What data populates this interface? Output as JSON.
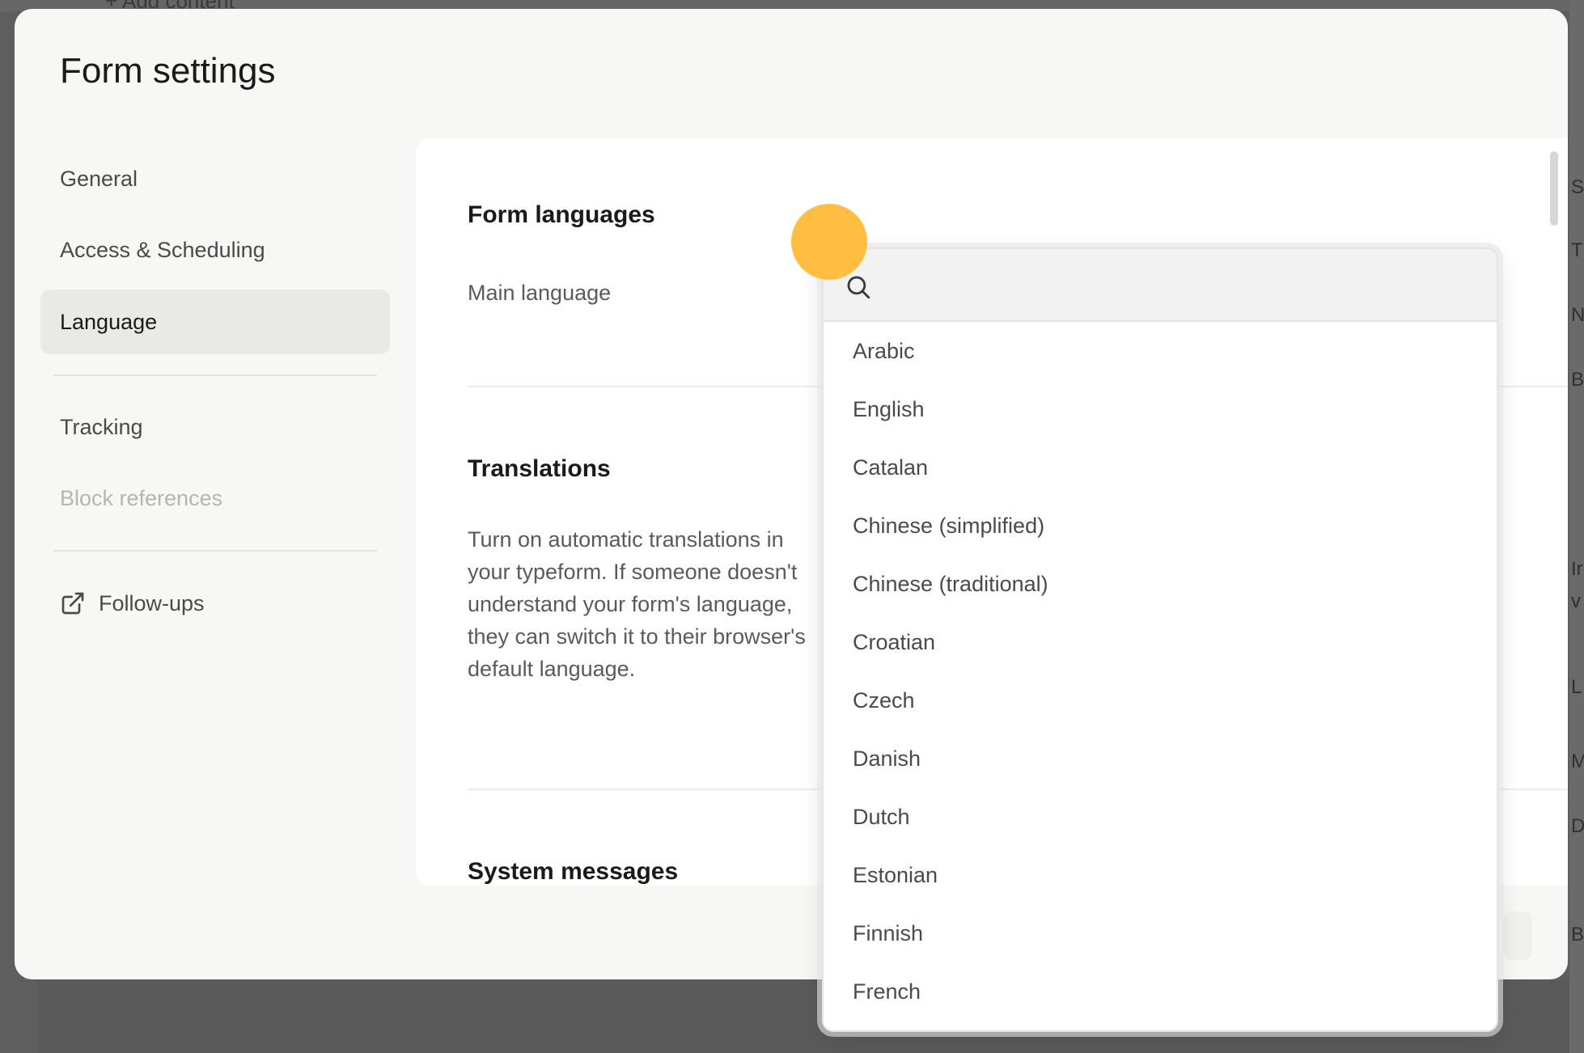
{
  "background": {
    "topbar_text": "+  Add content",
    "right_letters": [
      "S",
      "T",
      "N",
      "B",
      "Ir",
      "v",
      "L",
      "M",
      "D",
      "B"
    ]
  },
  "modal": {
    "title": "Form settings",
    "nav": [
      {
        "label": "General",
        "state": "normal"
      },
      {
        "label": "Access & Scheduling",
        "state": "normal"
      },
      {
        "label": "Language",
        "state": "active"
      },
      {
        "label": "Tracking",
        "state": "normal"
      },
      {
        "label": "Block references",
        "state": "disabled"
      },
      {
        "label": "Follow-ups",
        "state": "external",
        "icon": "external-link-icon"
      }
    ],
    "content": {
      "form_languages_title": "Form languages",
      "main_language_label": "Main language",
      "translations_title": "Translations",
      "translations_desc": "Turn on automatic translations in your typeform. If someone doesn't understand your form's language, they can switch it to their browser's default language.",
      "system_messages_title": "System messages"
    }
  },
  "dropdown": {
    "search_placeholder": "",
    "search_icon": "search-icon",
    "options": [
      "Arabic",
      "English",
      "Catalan",
      "Chinese (simplified)",
      "Chinese (traditional)",
      "Croatian",
      "Czech",
      "Danish",
      "Dutch",
      "Estonian",
      "Finnish",
      "French"
    ]
  },
  "colors": {
    "cursor_indicator": "#ffb938",
    "active_nav_bg": "#e9e9e7",
    "modal_bg": "#f7f7f5"
  }
}
